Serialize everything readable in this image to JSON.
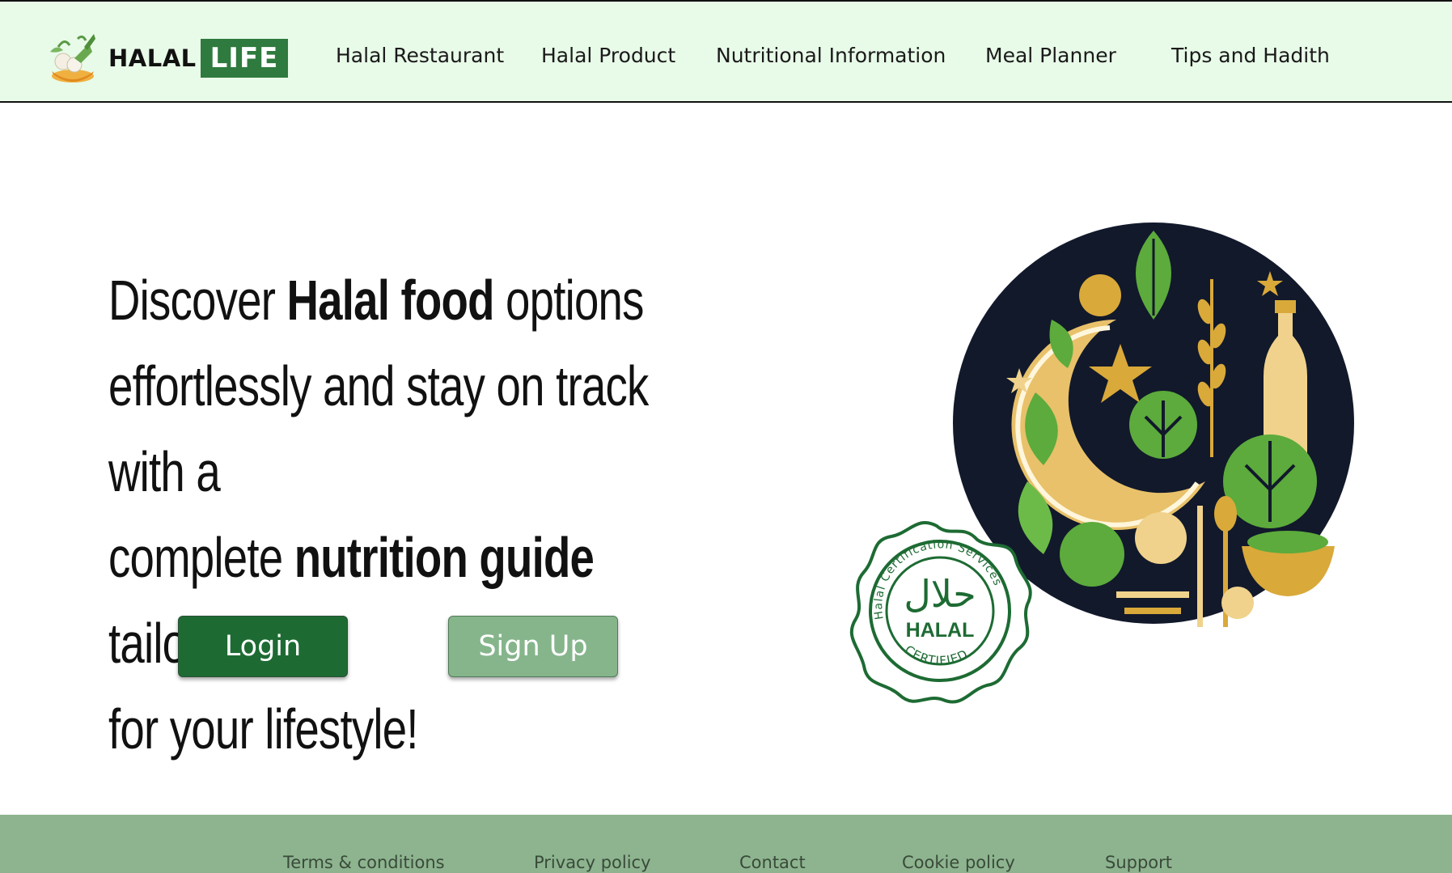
{
  "brand": {
    "word1": "HALAL",
    "word2": "LIFE",
    "logo_icon": "food-bowl-icon"
  },
  "nav": {
    "items": [
      {
        "label": "Halal Restaurant"
      },
      {
        "label": "Halal Product"
      },
      {
        "label": "Nutritional Information"
      },
      {
        "label": "Meal Planner"
      },
      {
        "label": "Tips and Hadith"
      }
    ]
  },
  "hero": {
    "line1_a": "Discover ",
    "line1_bold": "Halal food",
    "line1_b": " options",
    "line2": "effortlessly and stay on track with a",
    "line3_a": "complete ",
    "line3_bold": "nutrition guide",
    "line3_b": " tailored",
    "line4": "for your lifestyle!"
  },
  "buttons": {
    "login": "Login",
    "signup": "Sign Up"
  },
  "seal": {
    "ring_text": "Halal Certification Services",
    "arabic": "حلال",
    "main": "HALAL",
    "bottom": "CERTIFIED"
  },
  "footer": {
    "links": [
      {
        "label": "Terms & conditions"
      },
      {
        "label": "Privacy policy"
      },
      {
        "label": "Contact"
      },
      {
        "label": "Cookie policy"
      },
      {
        "label": "Support"
      }
    ]
  },
  "colors": {
    "header_bg": "#e8fae8",
    "brand_green": "#2f7a3e",
    "login_bg": "#1d6b33",
    "signup_bg": "#86b58c",
    "footer_bg": "#8db48f",
    "gold": "#d9a93a",
    "navy": "#12192b"
  }
}
